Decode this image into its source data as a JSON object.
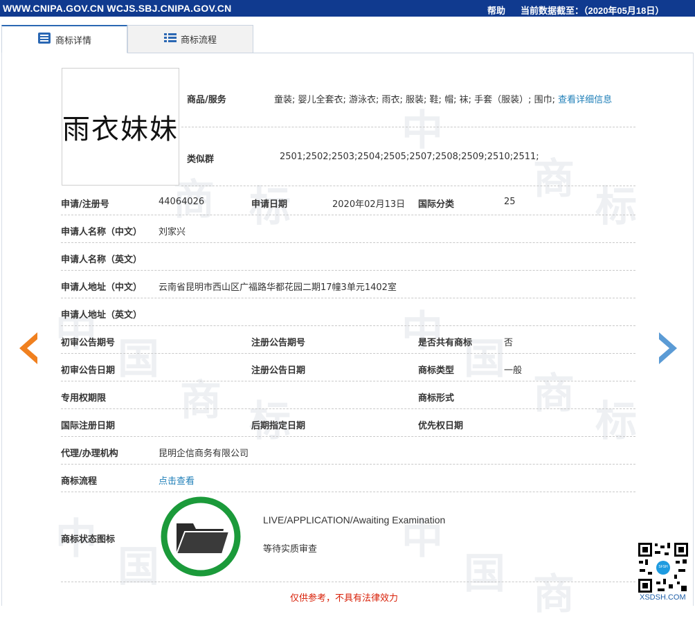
{
  "header": {
    "urls": "WWW.CNIPA.GOV.CN WCJS.SBJ.CNIPA.GOV.CN",
    "help": "帮助",
    "data_date": "当前数据截至：（2020年05月18日）"
  },
  "tabs": [
    {
      "label": "商标详情",
      "icon": "list-detail-icon",
      "active": true
    },
    {
      "label": "商标流程",
      "icon": "list-flow-icon",
      "active": false
    }
  ],
  "logo_text": "雨衣妹妹",
  "goods": {
    "label": "商品/服务",
    "value": "童装; 婴儿全套衣; 游泳衣; 雨衣; 服装; 鞋; 帽; 袜; 手套（服装）; 围巾;",
    "link": "查看详细信息"
  },
  "similar": {
    "label": "类似群",
    "value": "2501;2502;2503;2504;2505;2507;2508;2509;2510;2511;"
  },
  "fields": {
    "reg_no_label": "申请/注册号",
    "reg_no": "44064026",
    "apply_date_label": "申请日期",
    "apply_date": "2020年02月13日",
    "intl_class_label": "国际分类",
    "intl_class": "25",
    "applicant_cn_label": "申请人名称（中文）",
    "applicant_cn": "刘家兴",
    "applicant_en_label": "申请人名称（英文）",
    "applicant_en": "",
    "address_cn_label": "申请人地址（中文）",
    "address_cn": "云南省昆明市西山区广福路华都花园二期17幢3单元1402室",
    "address_en_label": "申请人地址（英文）",
    "address_en": "",
    "prelim_no_label": "初审公告期号",
    "prelim_no": "",
    "reg_pub_no_label": "注册公告期号",
    "reg_pub_no": "",
    "shared_label": "是否共有商标",
    "shared": "否",
    "prelim_date_label": "初审公告日期",
    "prelim_date": "",
    "reg_pub_date_label": "注册公告日期",
    "reg_pub_date": "",
    "tm_type_label": "商标类型",
    "tm_type": "一般",
    "exclusive_label": "专用权期限",
    "exclusive": "",
    "tm_form_label": "商标形式",
    "tm_form": "",
    "intl_reg_date_label": "国际注册日期",
    "intl_reg_date": "",
    "later_date_label": "后期指定日期",
    "later_date": "",
    "priority_label": "优先权日期",
    "priority": "",
    "agent_label": "代理/办理机构",
    "agent": "昆明企信商务有限公司",
    "flow_label": "商标流程",
    "flow_link": "点击查看",
    "status_icon_label": "商标状态图标"
  },
  "status": {
    "en": "LIVE/APPLICATION/Awaiting Examination",
    "cn": "等待实质审查",
    "icon": "folder-icon",
    "ring_color": "#1b9a3a"
  },
  "disclaimer": "仅供参考，不具有法律效力",
  "qr": {
    "label": "XSDSH.COM",
    "badge": "SFSH"
  },
  "colors": {
    "topbar": "#103a8f",
    "arrow_left": "#f0801f",
    "arrow_right": "#5b9bd5",
    "link": "#1f7fb8",
    "disclaimer": "#d81e06"
  }
}
